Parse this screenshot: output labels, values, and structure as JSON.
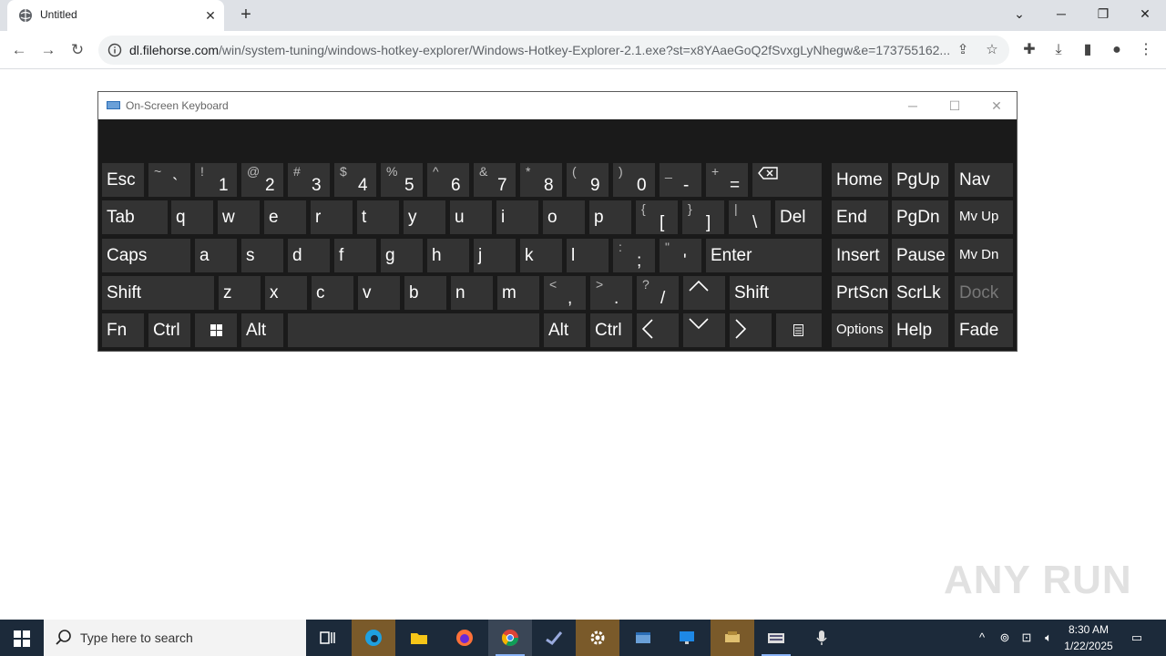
{
  "browser": {
    "tab_title": "Untitled",
    "url_host": "dl.filehorse.com",
    "url_path": "/win/system-tuning/windows-hotkey-explorer/Windows-Hotkey-Explorer-2.1.exe?st=x8YAaeGoQ2fSvxgLyNhegw&e=173755162..."
  },
  "osk": {
    "title": "On-Screen Keyboard",
    "keys": {
      "esc": "Esc",
      "tab": "Tab",
      "caps": "Caps",
      "shift": "Shift",
      "fn": "Fn",
      "ctrl": "Ctrl",
      "alt": "Alt",
      "del": "Del",
      "enter": "Enter",
      "shift_r": "Shift",
      "alt_r": "Alt",
      "ctrl_r": "Ctrl",
      "home": "Home",
      "pgup": "PgUp",
      "nav": "Nav",
      "end": "End",
      "pgdn": "PgDn",
      "mvup": "Mv Up",
      "insert": "Insert",
      "pause": "Pause",
      "mvdn": "Mv Dn",
      "prtscn": "PrtScn",
      "scrlk": "ScrLk",
      "dock": "Dock",
      "options": "Options",
      "help": "Help",
      "fade": "Fade"
    },
    "number_row": [
      {
        "up": "~",
        "low": "`"
      },
      {
        "up": "!",
        "low": "1"
      },
      {
        "up": "@",
        "low": "2"
      },
      {
        "up": "#",
        "low": "3"
      },
      {
        "up": "$",
        "low": "4"
      },
      {
        "up": "%",
        "low": "5"
      },
      {
        "up": "^",
        "low": "6"
      },
      {
        "up": "&",
        "low": "7"
      },
      {
        "up": "*",
        "low": "8"
      },
      {
        "up": "(",
        "low": "9"
      },
      {
        "up": ")",
        "low": "0"
      },
      {
        "up": "_",
        "low": "-"
      },
      {
        "up": "+",
        "low": "="
      }
    ],
    "row_q": [
      "q",
      "w",
      "e",
      "r",
      "t",
      "y",
      "u",
      "i",
      "o",
      "p"
    ],
    "row_q_sym": [
      {
        "up": "{",
        "low": "["
      },
      {
        "up": "}",
        "low": "]"
      },
      {
        "up": "|",
        "low": "\\"
      }
    ],
    "row_a": [
      "a",
      "s",
      "d",
      "f",
      "g",
      "h",
      "j",
      "k",
      "l"
    ],
    "row_a_sym": [
      {
        "up": ":",
        "low": ";"
      },
      {
        "up": "\"",
        "low": "'"
      }
    ],
    "row_z": [
      "z",
      "x",
      "c",
      "v",
      "b",
      "n",
      "m"
    ],
    "row_z_sym": [
      {
        "up": "<",
        "low": ","
      },
      {
        "up": ">",
        "low": "."
      },
      {
        "up": "?",
        "low": "/"
      }
    ]
  },
  "taskbar": {
    "search_placeholder": "Type here to search",
    "time": "8:30 AM",
    "date": "1/22/2025"
  },
  "watermark": "ANY RUN"
}
